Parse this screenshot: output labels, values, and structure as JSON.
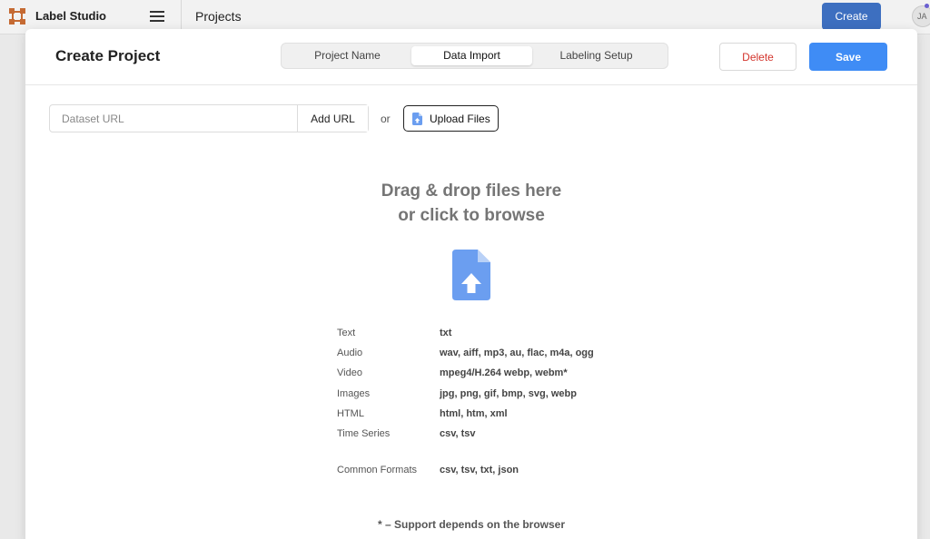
{
  "app": {
    "name": "Label Studio",
    "breadcrumb": "Projects",
    "create_label": "Create",
    "avatar_initials": "JA",
    "brand_color": "#c56a33"
  },
  "modal": {
    "title": "Create Project",
    "tabs": [
      {
        "label": "Project Name",
        "active": false
      },
      {
        "label": "Data Import",
        "active": true
      },
      {
        "label": "Labeling Setup",
        "active": false
      }
    ],
    "delete_label": "Delete",
    "save_label": "Save"
  },
  "import": {
    "url_placeholder": "Dataset URL",
    "add_url_label": "Add URL",
    "or_text": "or",
    "upload_label": "Upload Files",
    "drop_line1": "Drag & drop files here",
    "drop_line2": "or click to browse",
    "formats": [
      {
        "name": "Text",
        "exts": "txt"
      },
      {
        "name": "Audio",
        "exts": "wav, aiff, mp3, au, flac, m4a, ogg"
      },
      {
        "name": "Video",
        "exts": "mpeg4/H.264 webp, webm*"
      },
      {
        "name": "Images",
        "exts": "jpg, png, gif, bmp, svg, webp"
      },
      {
        "name": "HTML",
        "exts": "html, htm, xml"
      },
      {
        "name": "Time Series",
        "exts": "csv, tsv"
      },
      {
        "name": "Common Formats",
        "exts": "csv, tsv, txt, json"
      }
    ],
    "footnote": "* – Support depends on the browser"
  },
  "colors": {
    "primary": "#3f8cf5",
    "danger": "#d3342c",
    "icon_blue": "#6b9ef0"
  }
}
